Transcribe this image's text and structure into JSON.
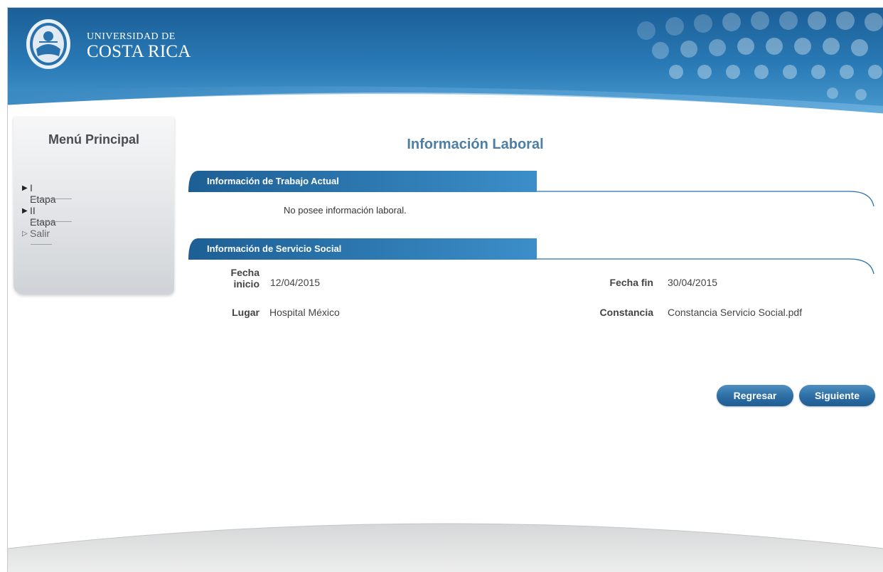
{
  "header": {
    "logo_line1": "UNIVERSIDAD DE",
    "logo_line2": "COSTA RICA"
  },
  "sidebar": {
    "title": "Menú Principal",
    "items": [
      {
        "label": "I Etapa"
      },
      {
        "label": "II Etapa"
      },
      {
        "label": "Salir"
      }
    ]
  },
  "main": {
    "title": "Información Laboral",
    "current_job": {
      "header": "Información de Trabajo Actual",
      "empty_text": "No posee información laboral."
    },
    "social_service": {
      "header": "Información de Servicio Social",
      "start_label_1": "Fecha",
      "start_label_2": "inicio",
      "start_value": "12/04/2015",
      "end_label": "Fecha fin",
      "end_value": "30/04/2015",
      "place_label": "Lugar",
      "place_value": "Hospital México",
      "certificate_label": "Constancia",
      "certificate_value": "Constancia Servicio Social.pdf"
    },
    "buttons": {
      "back": "Regresar",
      "next": "Siguiente"
    }
  },
  "colors": {
    "header_blue": "#1e6fa8",
    "title_blue": "#4d7ea4",
    "button_blue": "#2c6da3"
  }
}
